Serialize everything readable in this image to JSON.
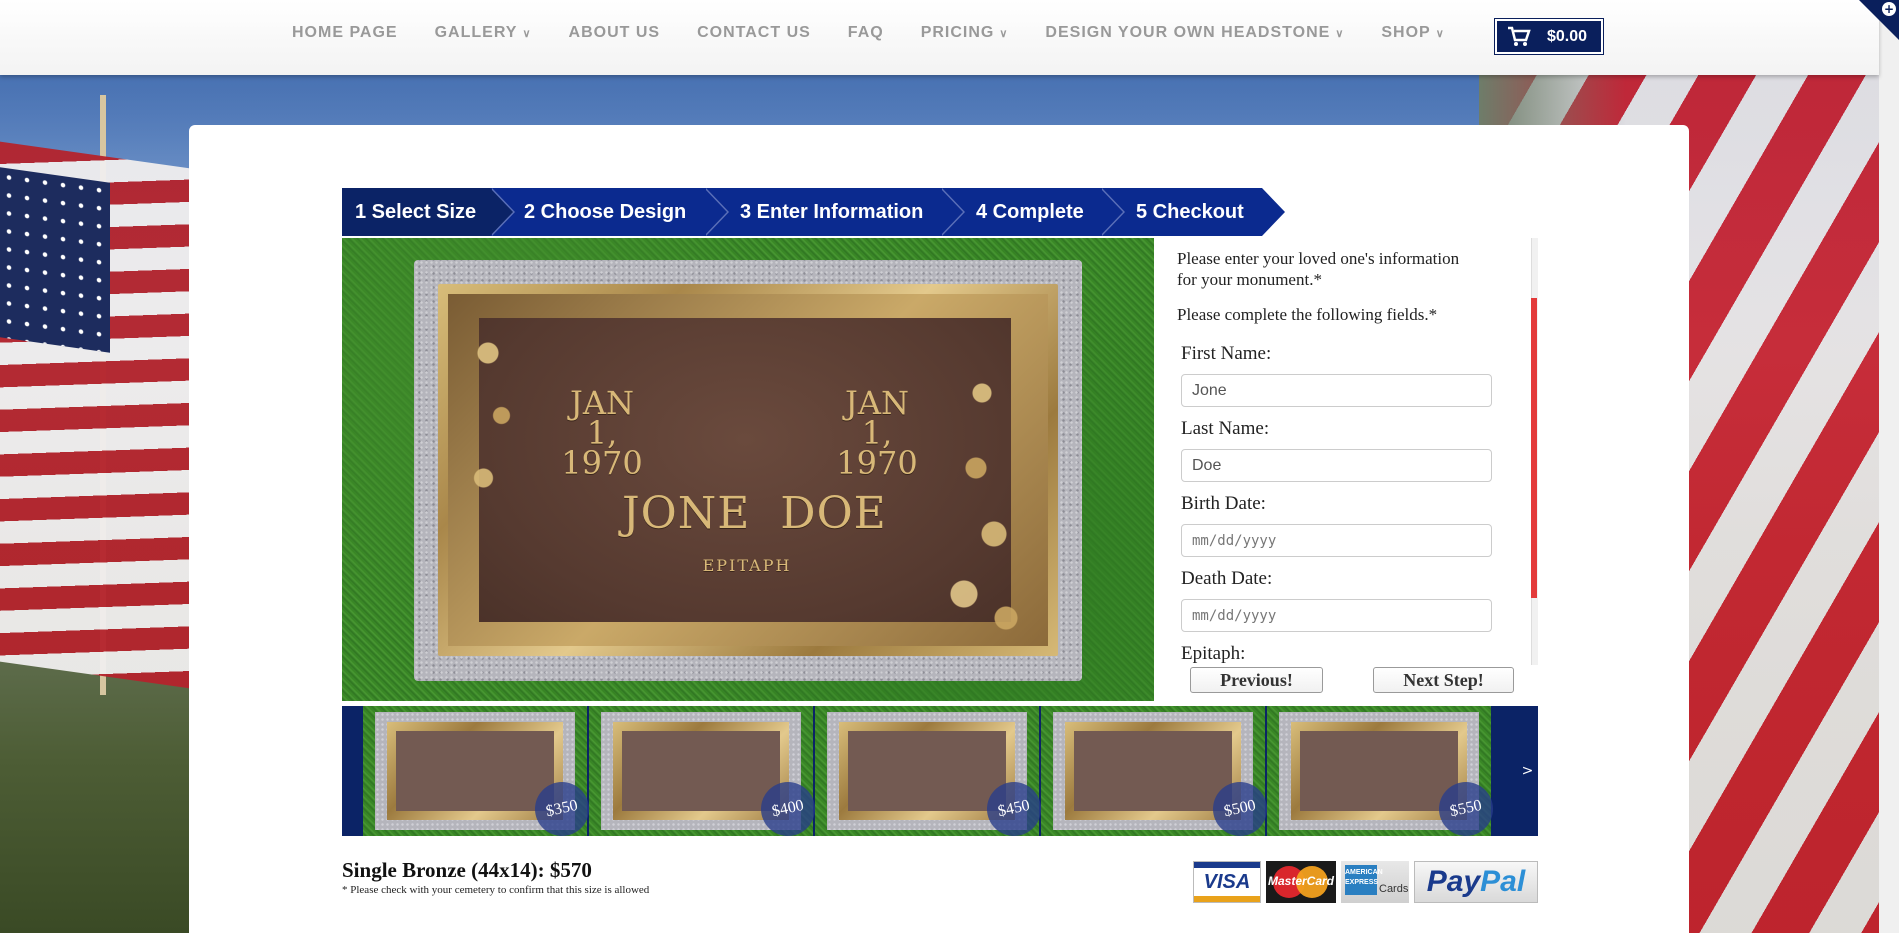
{
  "nav": {
    "items": [
      {
        "label": "HOME PAGE",
        "has_menu": false
      },
      {
        "label": "GALLERY",
        "has_menu": true
      },
      {
        "label": "ABOUT US",
        "has_menu": false
      },
      {
        "label": "CONTACT US",
        "has_menu": false
      },
      {
        "label": "FAQ",
        "has_menu": false
      },
      {
        "label": "PRICING",
        "has_menu": true
      },
      {
        "label": "DESIGN YOUR OWN HEADSTONE",
        "has_menu": true
      },
      {
        "label": "SHOP",
        "has_menu": true
      }
    ],
    "cart_total": "$0.00"
  },
  "steps": [
    {
      "label": "1 Select Size"
    },
    {
      "label": "2 Choose Design"
    },
    {
      "label": "3 Enter Information"
    },
    {
      "label": "4 Complete"
    },
    {
      "label": "5 Checkout"
    }
  ],
  "preview": {
    "birth_date_line1": "JAN 1,",
    "birth_date_line2": "1970",
    "death_date_line1": "JAN 1,",
    "death_date_line2": "1970",
    "name": "JONE  DOE",
    "epitaph": "EPITAPH"
  },
  "form": {
    "intro": "Please enter your loved one's information for your monument.*",
    "instructions": "Please complete the following fields.*",
    "first_name": {
      "label": "First Name:",
      "value": "Jone"
    },
    "last_name": {
      "label": "Last Name:",
      "value": "Doe"
    },
    "birth_date": {
      "label": "Birth Date:",
      "placeholder": "mm/dd/yyyy"
    },
    "death_date": {
      "label": "Death Date:",
      "placeholder": "mm/dd/yyyy"
    },
    "epitaph": {
      "label": "Epitaph:"
    }
  },
  "buttons": {
    "previous": "Previous!",
    "next": "Next Step!"
  },
  "carousel": {
    "designs": [
      {
        "price": "$350"
      },
      {
        "price": "$400"
      },
      {
        "price": "$450"
      },
      {
        "price": "$500"
      },
      {
        "price": "$550"
      }
    ],
    "next_label": ">"
  },
  "product": {
    "title": "Single Bronze (44x14): $570",
    "note": "* Please check with your cemetery to confirm that this size is allowed"
  },
  "payment": {
    "visa": "VISA",
    "mastercard": "MasterCard",
    "amex_box": "AMERICAN EXPRESS",
    "amex_label": "Cards",
    "paypal_1": "Pay",
    "paypal_2": "Pal"
  }
}
